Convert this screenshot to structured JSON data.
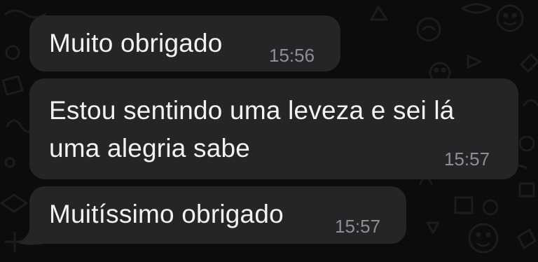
{
  "chat": {
    "messages": [
      {
        "lines": [
          "Muito obrigado"
        ],
        "time": "15:56"
      },
      {
        "lines": [
          "Estou sentindo uma leveza e sei lá",
          "uma alegria sabe"
        ],
        "time": "15:57"
      },
      {
        "lines": [
          "Muitíssimo obrigado"
        ],
        "time": "15:57"
      }
    ]
  },
  "colors": {
    "background": "#0c0c0c",
    "bubble": "#242527",
    "text": "#f2f2f2",
    "timestamp": "#8e8e93",
    "doodle": "#1b1b1b"
  }
}
